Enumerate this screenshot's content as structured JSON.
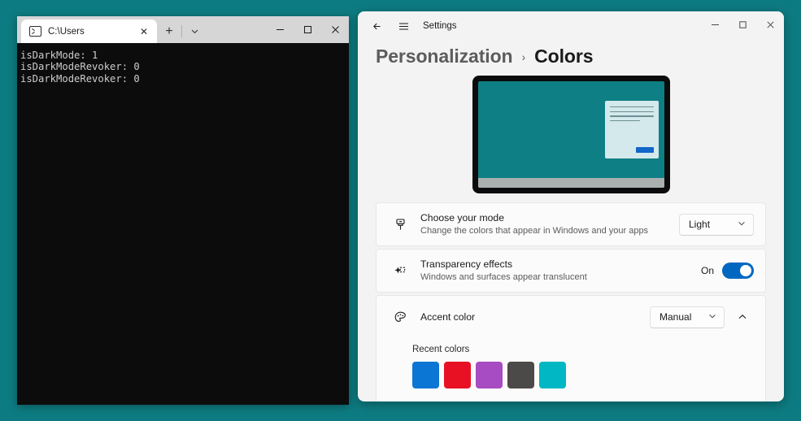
{
  "desktop": {
    "background_color": "#0d7c82"
  },
  "terminal": {
    "tab": {
      "title": "C:\\Users",
      "icon": "terminal-icon",
      "close_label": "✕"
    },
    "newtab_label": "+",
    "dropdown_label": "⌄",
    "window_controls": {
      "minimize": "—",
      "maximize": "◻",
      "close": "✕"
    },
    "output_lines": [
      "isDarkMode: 1",
      "isDarkModeRevoker: 0",
      "isDarkModeRevoker: 0"
    ]
  },
  "settings": {
    "back_label": "←",
    "menu_label": "☰",
    "app_title": "Settings",
    "window_controls": {
      "minimize": "—",
      "maximize": "◻",
      "close": "✕"
    },
    "breadcrumb": {
      "parent": "Personalization",
      "separator": "›",
      "current": "Colors"
    },
    "preview": {
      "wallpaper_color": "#0e7f85",
      "taskbar_color": "#aab0b0",
      "dialog_color": "#d3e9ec",
      "dialog_button_color": "#1266c8"
    },
    "rows": [
      {
        "icon": "brush-icon",
        "title": "Choose your mode",
        "subtitle": "Change the colors that appear in Windows and your apps",
        "control": "dropdown",
        "value": "Light"
      },
      {
        "icon": "transparency-sparkle-icon",
        "title": "Transparency effects",
        "subtitle": "Windows and surfaces appear translucent",
        "control": "toggle",
        "value": "On"
      },
      {
        "icon": "palette-icon",
        "title": "Accent color",
        "subtitle": "",
        "control": "dropdown-expand",
        "value": "Manual",
        "expand_label": "⌃"
      }
    ],
    "accent_panel": {
      "recent_label": "Recent colors",
      "recent_colors": [
        "#0c76d4",
        "#e81123",
        "#a74cc2",
        "#4c4a48",
        "#00b7c3"
      ]
    },
    "accent_highlight_color": "#0067c0"
  }
}
